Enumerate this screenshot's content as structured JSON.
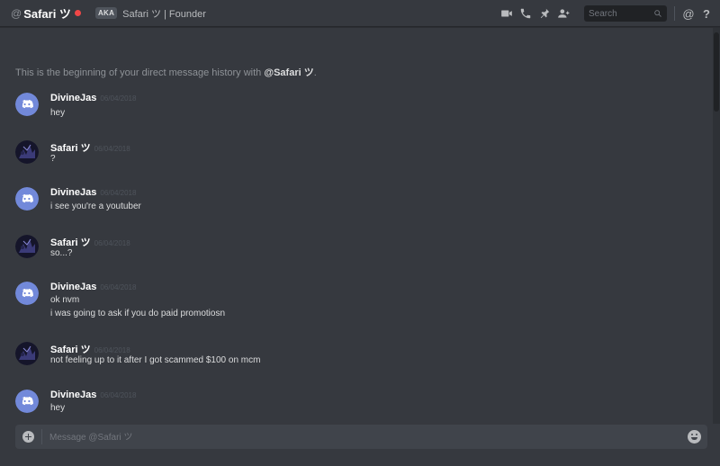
{
  "header": {
    "at_symbol": "@",
    "username": "Safari ツ",
    "status_color": "#f04747",
    "aka_badge": "AKA",
    "nickname": "Safari ツ | Founder",
    "icons": [
      "video-call-icon",
      "voice-call-icon",
      "pin-icon",
      "add-friend-icon"
    ],
    "search_placeholder": "Search",
    "mention_symbol": "@",
    "help_symbol": "?"
  },
  "intro": {
    "prefix": "This is the beginning of your direct message history with ",
    "handle": "@Safari ツ",
    "suffix": "."
  },
  "messages": [
    {
      "author": "DivineJas",
      "avatar": "discord-default-avatar",
      "timestamp": "06/04/2018",
      "lines": [
        "hey"
      ]
    },
    {
      "author": "Safari ツ",
      "avatar": "dark-profile-avatar",
      "timestamp": "06/04/2018",
      "lines": [
        "?"
      ]
    },
    {
      "author": "DivineJas",
      "avatar": "discord-default-avatar",
      "timestamp": "06/04/2018",
      "lines": [
        "i see you're a youtuber"
      ]
    },
    {
      "author": "Safari ツ",
      "avatar": "dark-profile-avatar",
      "timestamp": "06/04/2018",
      "lines": [
        "so...?"
      ]
    },
    {
      "author": "DivineJas",
      "avatar": "discord-default-avatar",
      "timestamp": "06/04/2018",
      "lines": [
        "ok nvm",
        "i was going to ask if you do paid promotiosn"
      ]
    },
    {
      "author": "Safari ツ",
      "avatar": "dark-profile-avatar",
      "timestamp": "06/04/2018",
      "lines": [
        "not feeling up to it after I got scammed $100 on mcm"
      ]
    },
    {
      "author": "DivineJas",
      "avatar": "discord-default-avatar",
      "timestamp": "06/04/2018",
      "lines": [
        "hey"
      ]
    }
  ],
  "composer": {
    "placeholder": "Message @Safari ツ",
    "value": ""
  },
  "colors": {
    "background": "#36393f",
    "blurple": "#7289da",
    "text": "#dcddde",
    "muted": "#72767d"
  }
}
